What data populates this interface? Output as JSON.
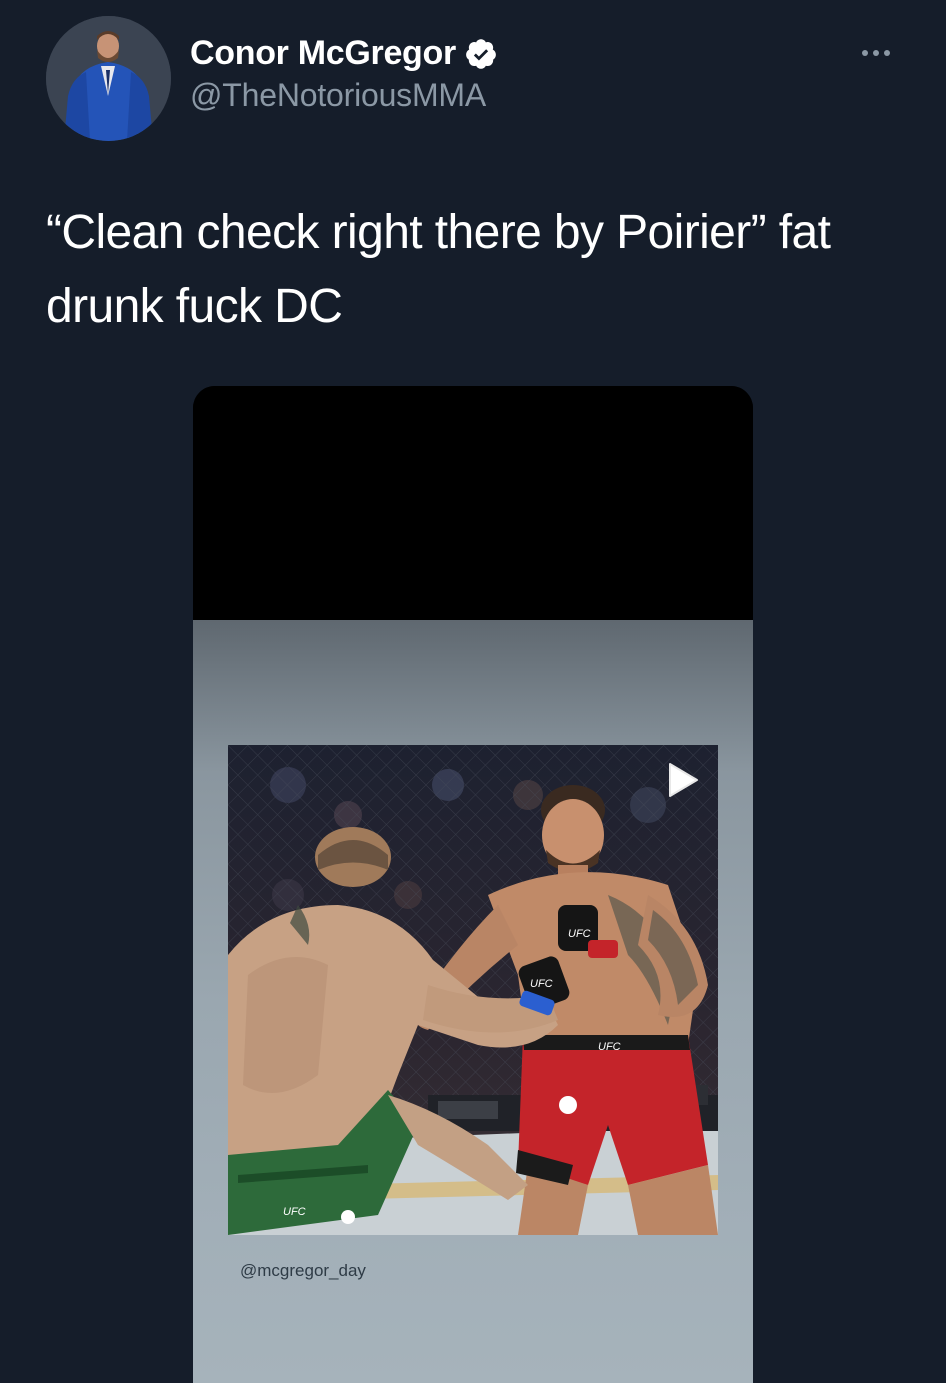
{
  "tweet": {
    "author": {
      "display_name": "Conor McGregor",
      "handle": "@TheNotoriousMMA",
      "verified": true,
      "verified_icon": "verified-badge-icon",
      "more_icon": "more-options-icon"
    },
    "text_line_1": "“Clean check right there by Poirier” fat",
    "text_line_2": "drunk fuck DC",
    "media": {
      "story_credit": "@mcgregor_day",
      "play_icon": "play-icon",
      "trunks_label_left": "UFC",
      "trunks_label_right": "UFC",
      "glove_label_1": "UFC",
      "glove_label_2": "UFC"
    }
  },
  "colors": {
    "background": "#151d2a",
    "text_primary": "#ffffff",
    "text_secondary": "#8b98a5"
  }
}
